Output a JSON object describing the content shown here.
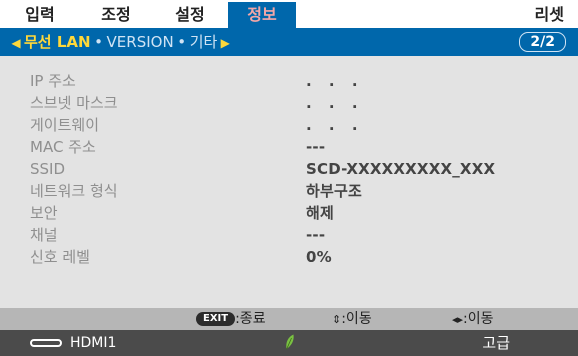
{
  "menu": {
    "tabs": [
      {
        "label": "입력"
      },
      {
        "label": "조정"
      },
      {
        "label": "설정"
      },
      {
        "label": "정보"
      }
    ],
    "reset_label": "리셋"
  },
  "subtabs": {
    "items": [
      {
        "label": "무선 LAN"
      },
      {
        "label": "VERSION"
      },
      {
        "label": "기타"
      }
    ],
    "separator": "•",
    "page_indicator": "2/2"
  },
  "info_rows": [
    {
      "label": "IP 주소",
      "value": ". . ."
    },
    {
      "label": "스브넷 마스크",
      "value": ". . ."
    },
    {
      "label": "게이트웨이",
      "value": ". . ."
    },
    {
      "label": "MAC 주소",
      "value": "---"
    },
    {
      "label": "SSID",
      "value": "SCD-XXXXXXXXX_XXX"
    },
    {
      "label": "네트워크 형식",
      "value": "하부구조"
    },
    {
      "label": "보안",
      "value": "해제"
    },
    {
      "label": "채널",
      "value": "---"
    },
    {
      "label": "신호 레벨",
      "value": "0%"
    }
  ],
  "help": {
    "exit_key": "EXIT",
    "exit_label": ":종료",
    "updown_glyph": "⇕",
    "updown_label": ":이동",
    "leftright_glyph": "◂▸",
    "leftright_label": ":이동"
  },
  "status": {
    "input": "HDMI1",
    "icon": "eco-leaf-icon",
    "mode": "고급"
  },
  "colors": {
    "accent_blue": "#0067ab",
    "active_tab_text": "#f4a7a7",
    "subtab_active": "#ffd83a",
    "eco_green": "#7ac142"
  }
}
